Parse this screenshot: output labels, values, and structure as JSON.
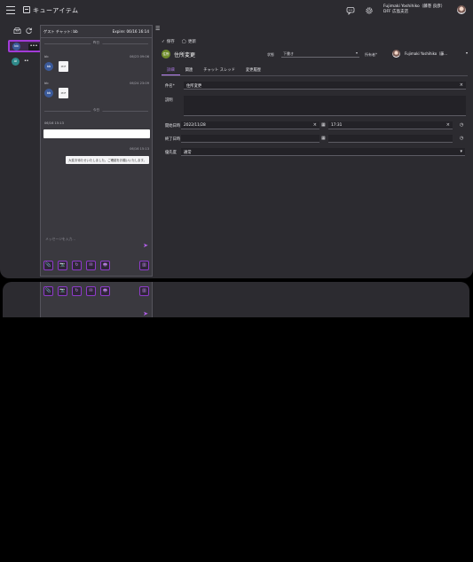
{
  "app": {
    "title": "キューアイテム",
    "user_name": "Fujimaki Yoshihiko（藤巻 良彦）",
    "user_org": "DFF 広島支店"
  },
  "rail": {
    "active_room_avatar": "bb",
    "active_room_more": "•••",
    "other_room_avatar": "AI",
    "other_room_dots": "••"
  },
  "chat": {
    "title": "ゲスト チャット: bb",
    "expire": "Expire: 06/16 16:14",
    "divider_yesterday": "昨日",
    "messages": [
      {
        "sender": "bb",
        "time": "06/23 09:06",
        "avatar": "bb",
        "file_label": "PDF"
      },
      {
        "sender": "bb",
        "time": "06/24 23:09",
        "avatar": "bb",
        "file_label": "PDF"
      }
    ],
    "divider_today": "今日",
    "today_time": "06/16 15:13",
    "reply_time": "06/16 15:13",
    "reply_text": "大変お待たせいたしました。ご確認をお願いいたします。",
    "compose_placeholder": "メッセージを入力...",
    "send_icon": "➤",
    "tools": [
      "📎",
      "📷",
      "↻",
      "✉",
      "🖶",
      "▥"
    ]
  },
  "detail": {
    "actions": {
      "save": "保存",
      "update": "更新"
    },
    "item": {
      "badge": "住所",
      "name": "住所変更"
    },
    "status_label": "状態",
    "status_value": "下書き",
    "owner_label": "所有者*",
    "owner_value": "Fujimaki Yoshihiko（藤...",
    "tabs": [
      "詳細",
      "関連",
      "チャット スレッド",
      "変更履歴"
    ],
    "fields": {
      "subject_label": "件名*",
      "subject_value": "住所変更",
      "description_label": "説明",
      "start_label": "開始日時",
      "start_date": "2022/11/28",
      "start_time": "17:31",
      "end_label": "終了日時",
      "priority_label": "優先度",
      "priority_value": "通常"
    }
  }
}
